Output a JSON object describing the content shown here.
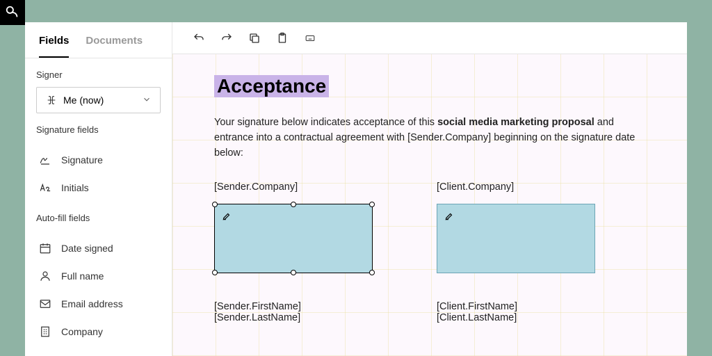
{
  "tabs": {
    "fields": "Fields",
    "documents": "Documents"
  },
  "signer": {
    "label": "Signer",
    "value": "Me (now)"
  },
  "sections": {
    "signature": "Signature fields",
    "autofill": "Auto-fill fields"
  },
  "sigFields": {
    "signature": "Signature",
    "initials": "Initials"
  },
  "autoFields": {
    "dateSigned": "Date signed",
    "fullName": "Full name",
    "emailAddress": "Email address",
    "company": "Company"
  },
  "doc": {
    "title": "Acceptance",
    "para_pre": "Your signature below indicates acceptance of this ",
    "para_bold": "social media marketing proposal",
    "para_post": " and entrance into a contractual agreement with [Sender.Company] beginning on the signature date below:",
    "senderCompany": "[Sender.Company]",
    "clientCompany": "[Client.Company]",
    "senderName": "[Sender.FirstName] [Sender.LastName]",
    "clientName": "[Client.FirstName] [Client.LastName]"
  }
}
